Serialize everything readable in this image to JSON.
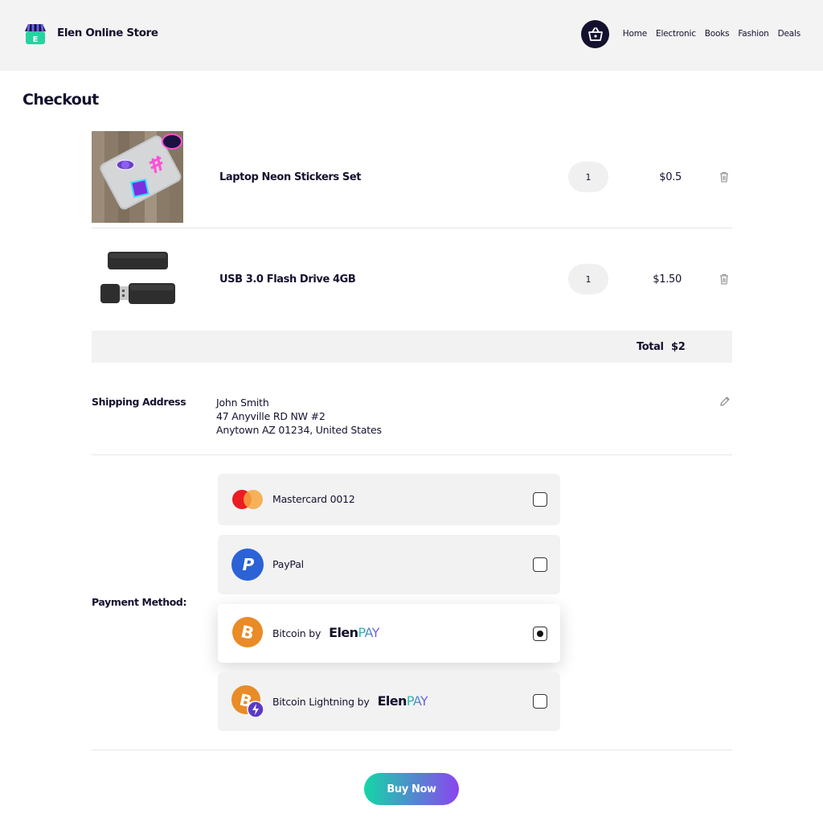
{
  "header": {
    "store_name": "Elen Online Store",
    "logo_letter": "E",
    "nav": [
      "Home",
      "Electronic",
      "Books",
      "Fashion",
      "Deals"
    ]
  },
  "page_title": "Checkout",
  "cart": {
    "items": [
      {
        "name": "Laptop Neon Stickers Set",
        "quantity": "1",
        "price": "$0.5",
        "image": "laptop-stickers-photo"
      },
      {
        "name": "USB 3.0 Flash Drive 4GB",
        "quantity": "1",
        "price": "$1.50",
        "image": "usb-flash-drive-photo"
      }
    ],
    "total_label": "Total",
    "total_value": "$2"
  },
  "shipping": {
    "label": "Shipping Address",
    "lines": [
      "John Smith",
      "47 Anyville RD NW #2",
      "Anytown AZ 01234, United States"
    ]
  },
  "payment": {
    "label": "Payment Method:",
    "brand_elen": "Elen",
    "brand_pay": "PAY",
    "options": [
      {
        "label": "Mastercard 0012",
        "icon": "mastercard-icon",
        "selected": false
      },
      {
        "label": "PayPal",
        "icon": "paypal-icon",
        "selected": false
      },
      {
        "label": "Bitcoin by",
        "icon": "bitcoin-icon",
        "selected": true
      },
      {
        "label": "Bitcoin Lightning by",
        "icon": "bitcoin-lightning-icon",
        "selected": false
      }
    ]
  },
  "buy_label": "Buy Now",
  "colors": {
    "header_bg": "#f3f3f3",
    "text_dark": "#14112e",
    "bitcoin_orange": "#e98b26",
    "paypal_blue": "#2b62d6",
    "button_gradient_start": "#14d6a6",
    "button_gradient_end": "#8b44f0"
  }
}
